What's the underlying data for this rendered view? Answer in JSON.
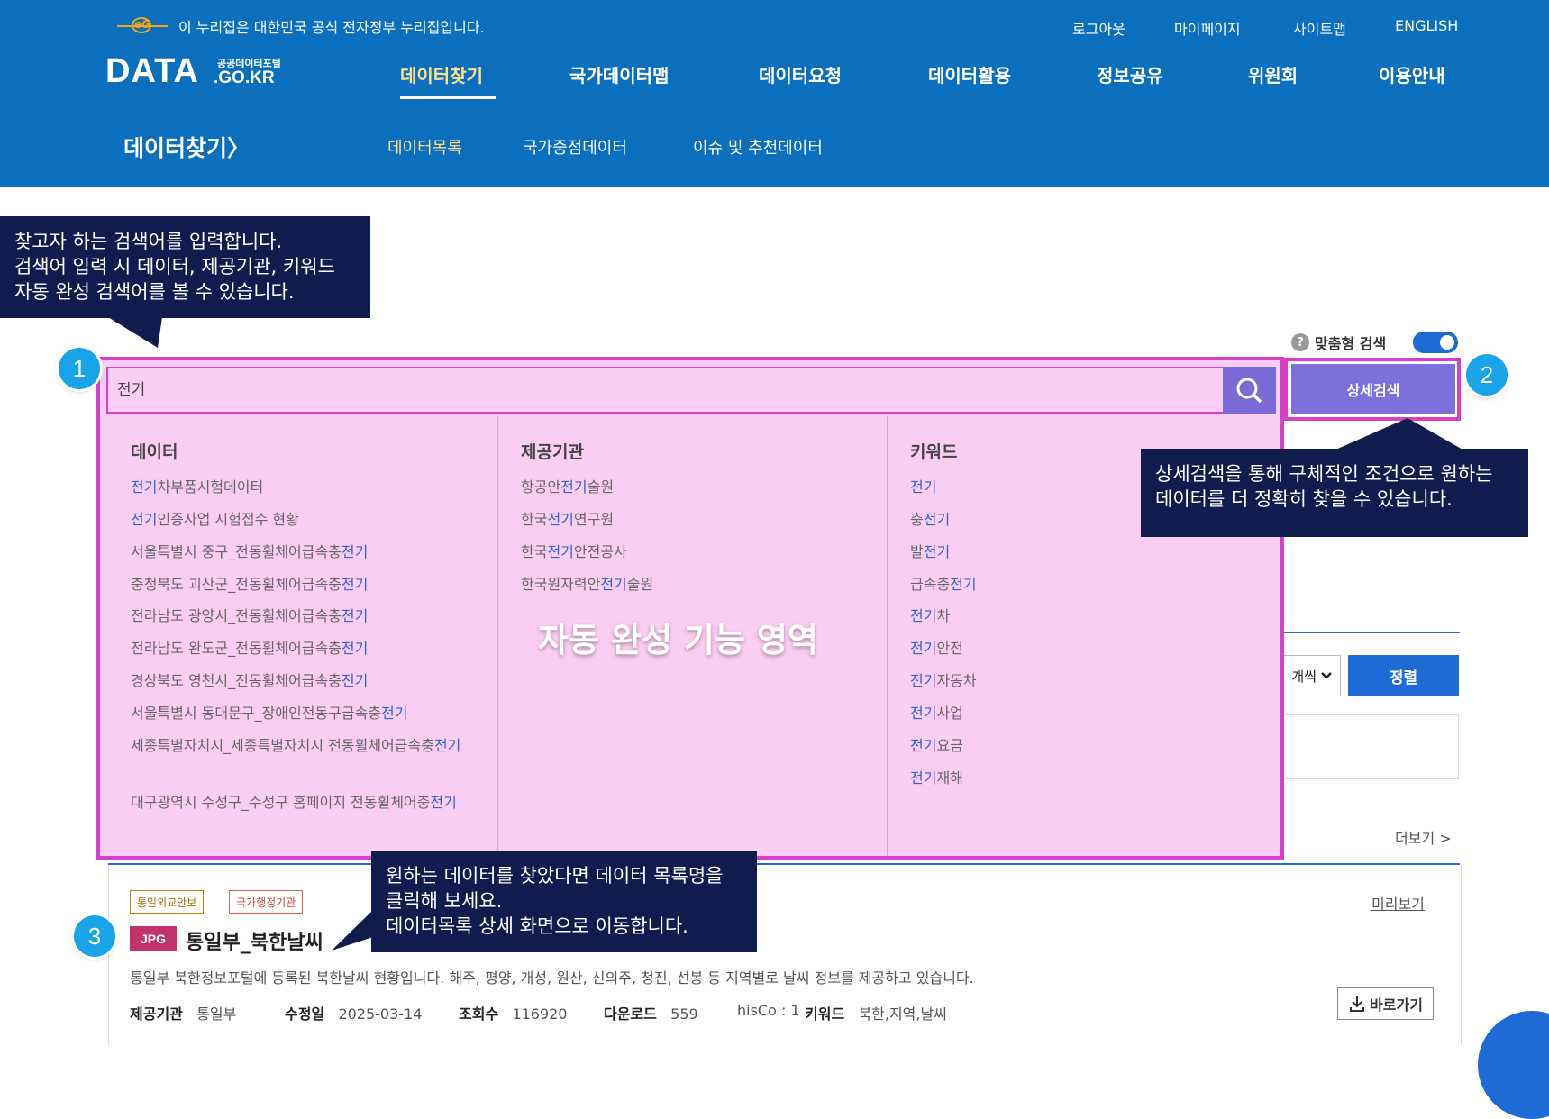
{
  "header": {
    "gov_notice": "이 누리집은 대한민국 공식 전자정부 누리집입니다.",
    "gov_logo_text": "eG",
    "util_links": [
      "로그아웃",
      "마이페이지",
      "사이트맵",
      "ENGLISH"
    ],
    "logo": {
      "main": "DATA",
      "sub_top": "공공데이터포털",
      "sub_bottom": ".GO.KR"
    },
    "gnb": [
      "데이터찾기",
      "국가데이터맵",
      "데이터요청",
      "데이터활용",
      "정보공유",
      "위원회",
      "이용안내"
    ],
    "section_title": "데이터찾기〉",
    "sub_menu": [
      "데이터목록",
      "국가중점데이터",
      "이슈 및 추천데이터"
    ]
  },
  "callouts": {
    "search_hint": [
      "찾고자 하는 검색어를 입력합니다.",
      "검색어 입력 시 데이터, 제공기관, 키워드",
      "자동 완성 검색어를 볼 수 있습니다."
    ],
    "detail_hint": [
      "상세검색을 통해 구체적인 조건으로 원하는",
      "데이터를 더 정확히 찾을 수 있습니다."
    ],
    "result_hint": [
      "원하는 데이터를 찾았다면 데이터 목록명을",
      "클릭해 보세요.",
      "데이터목록 상세 화면으로 이동합니다."
    ],
    "badges": [
      "1",
      "2",
      "3"
    ]
  },
  "search": {
    "value": "전기",
    "toggle_label": "맞춤형 검색",
    "help_icon": "?",
    "detail_button": "상세검색"
  },
  "autocomplete": {
    "area_label": "자동 완성 기능 영역",
    "columns": [
      {
        "title": "데이터",
        "items": [
          [
            "",
            "전기",
            "차부품시험데이터"
          ],
          [
            "",
            "전기",
            "인증사업 시험접수 현황"
          ],
          [
            "서울특별시 중구_전동휠체어급속충",
            "전기",
            ""
          ],
          [
            "충청북도 괴산군_전동휠체어급속충",
            "전기",
            ""
          ],
          [
            "전라남도 광양시_전동휠체어급속충",
            "전기",
            ""
          ],
          [
            "전라남도 완도군_전동휠체어급속충",
            "전기",
            ""
          ],
          [
            "경상북도 영천시_전동휠체어급속충",
            "전기",
            ""
          ],
          [
            "서울특별시 동대문구_장애인전동구급속충",
            "전기",
            ""
          ],
          [
            "세종특별자치시_세종특별자치시 전동휠체어급속충",
            "전기",
            ""
          ],
          [
            "대구광역시 수성구_수성구 홈페이지 전동휠체어충",
            "전기",
            ""
          ]
        ]
      },
      {
        "title": "제공기관",
        "items": [
          [
            "항공안",
            "전기",
            "술원"
          ],
          [
            "한국",
            "전기",
            "연구원"
          ],
          [
            "한국",
            "전기",
            "안전공사"
          ],
          [
            "한국원자력안",
            "전기",
            "술원"
          ]
        ]
      },
      {
        "title": "키워드",
        "items": [
          [
            "",
            "전기",
            ""
          ],
          [
            "충",
            "전기",
            ""
          ],
          [
            "발",
            "전기",
            ""
          ],
          [
            "급속충",
            "전기",
            ""
          ],
          [
            "",
            "전기",
            "차"
          ],
          [
            "",
            "전기",
            "안전"
          ],
          [
            "",
            "전기",
            "자동차"
          ],
          [
            "",
            "전기",
            "사업"
          ],
          [
            "",
            "전기",
            "요금"
          ],
          [
            "",
            "전기",
            "재해"
          ]
        ]
      }
    ]
  },
  "list_controls": {
    "per_page": "개씩",
    "sort_button": "정렬",
    "more": "더보기 >"
  },
  "result": {
    "tags": [
      "통일외교안보",
      "국가행정기관"
    ],
    "type": "JPG",
    "title": "통일부_북한날씨",
    "preview": "미리보기",
    "desc": "통일부 북한정보포털에 등록된 북한날씨 현황입니다. 해주, 평양, 개성, 원산, 신의주, 청진, 선봉 등 지역별로 날씨 정보를 제공하고 있습니다.",
    "meta": {
      "provider_label": "제공기관",
      "provider": "통일부",
      "modified_label": "수정일",
      "modified": "2025-03-14",
      "views_label": "조회수",
      "views": "116920",
      "downloads_label": "다운로드",
      "downloads": "559",
      "hisco": "hisCo : 1",
      "keywords_label": "키워드",
      "keywords": "북한,지역,날씨"
    },
    "goto_button": "바로가기"
  },
  "colors": {
    "header_bg": "#0c6fbd",
    "gnb_active": "#ffe18c",
    "callout_bg": "#0f1c4d",
    "badge": "#1aa4e8",
    "highlight_frame": "#d940c9",
    "overlay_bg": "#facdf2",
    "search_button": "#7b6bd8",
    "match_text": "#2f62d4",
    "primary_blue": "#1e6bd6",
    "type_badge": "#c0336f"
  }
}
